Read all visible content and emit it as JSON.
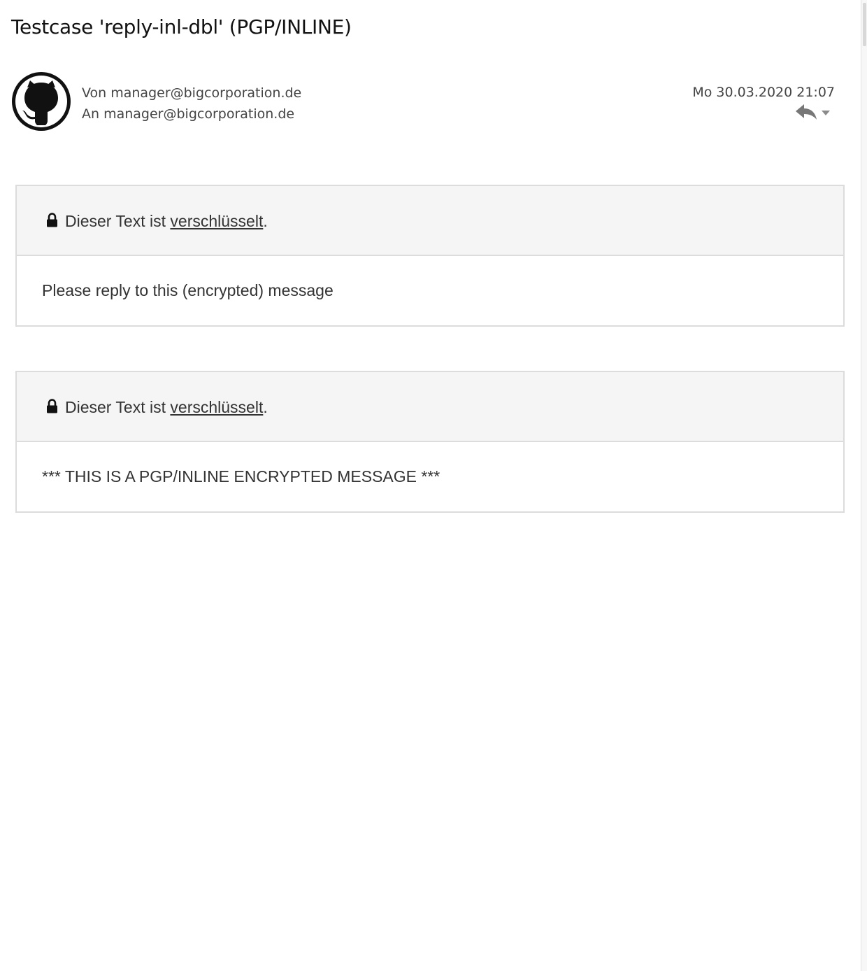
{
  "message": {
    "subject": "Testcase 'reply-inl-dbl' (PGP/INLINE)",
    "from_line": "Von manager@bigcorporation.de",
    "to_line": "An manager@bigcorporation.de",
    "date": "Mo 30.03.2020 21:07",
    "avatar": "github-octocat-icon"
  },
  "actions": {
    "reply_icon": "reply-arrow-icon",
    "more_icon": "chevron-down-icon"
  },
  "encrypted_blocks": [
    {
      "notice_prefix": "Dieser Text ist ",
      "notice_link": "verschlüsselt",
      "notice_suffix": ".",
      "body": "Please reply to this (encrypted) message"
    },
    {
      "notice_prefix": "Dieser Text ist ",
      "notice_link": "verschlüsselt",
      "notice_suffix": ".",
      "body": "*** THIS IS A PGP/INLINE ENCRYPTED MESSAGE ***"
    }
  ],
  "colors": {
    "text": "#333333",
    "header_bg": "#f5f5f5",
    "border": "#dcdcdc"
  }
}
